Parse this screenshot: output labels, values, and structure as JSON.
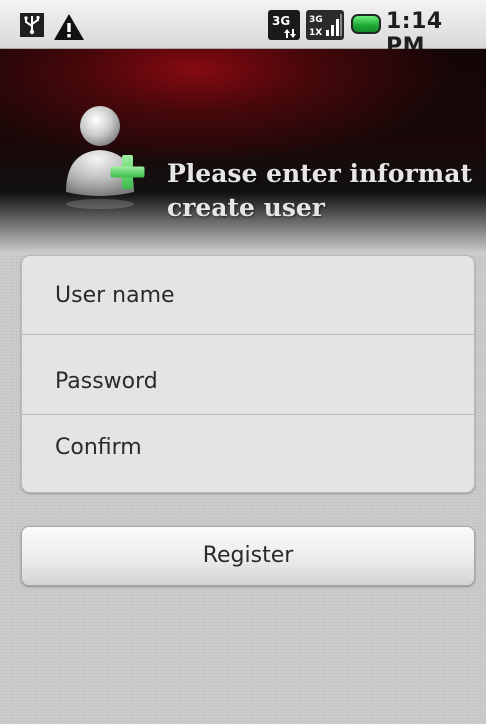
{
  "status_bar": {
    "time": "1:14 PM",
    "icons": [
      "usb-icon",
      "warning-icon",
      "3g-data-icon",
      "signal-3g-icon",
      "battery-icon"
    ],
    "battery_color": "#1da736"
  },
  "header": {
    "icon": "user-add-icon",
    "title": "Please enter information to create user",
    "title_line1": "Please enter informat",
    "title_line2": "create user",
    "accent_color": "#8c0a12"
  },
  "form": {
    "fields": [
      {
        "placeholder": "User name"
      },
      {
        "placeholder": "Password"
      },
      {
        "placeholder": "Confirm"
      }
    ]
  },
  "actions": {
    "register_label": "Register"
  }
}
